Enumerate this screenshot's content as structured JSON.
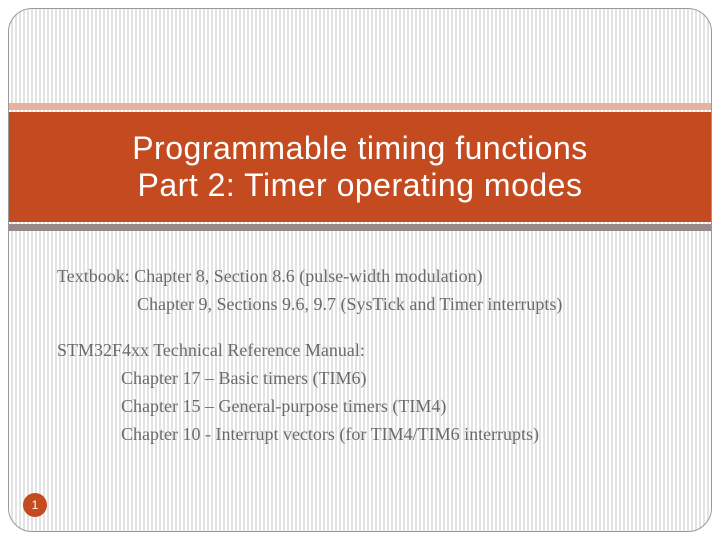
{
  "title": {
    "line1": "Programmable timing functions",
    "line2": "Part 2: Timer operating modes"
  },
  "content": {
    "textbook_line1": "Textbook:  Chapter 8, Section 8.6 (pulse-width modulation)",
    "textbook_line2": "Chapter 9, Sections 9.6, 9.7 (SysTick and Timer interrupts)",
    "trm_heading": "STM32F4xx Technical Reference Manual:",
    "trm_line1": "Chapter 17  – Basic timers (TIM6)",
    "trm_line2": "Chapter 15  – General-purpose timers (TIM4)",
    "trm_line3": "Chapter 10  -  Interrupt vectors (for TIM4/TIM6 interrupts)"
  },
  "page_number": "1"
}
